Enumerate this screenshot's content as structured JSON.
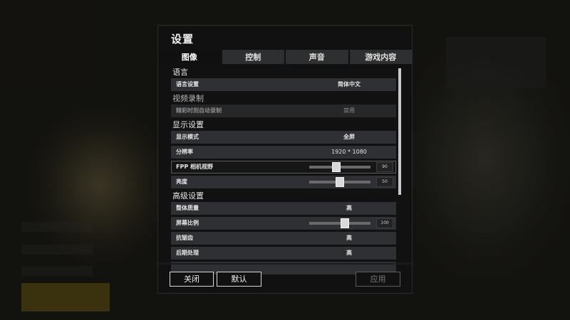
{
  "dialog": {
    "title": "设置",
    "tabs": [
      "图像",
      "控制",
      "声音",
      "游戏内容"
    ],
    "active_tab": "图像"
  },
  "sections": {
    "language": "语言",
    "video_record": "视频录制",
    "display": "显示设置",
    "advanced": "高级设置"
  },
  "rows": {
    "language_setting": {
      "label": "语言设置",
      "value": "简体中文"
    },
    "auto_record": {
      "label": "精彩时刻自动录制",
      "value": "禁用"
    },
    "display_mode": {
      "label": "显示模式",
      "value": "全屏"
    },
    "resolution": {
      "label": "分辨率",
      "value": "1920 * 1080"
    },
    "fpp_fov": {
      "label": "FPP 相机视野",
      "value": "90",
      "fraction": 0.43
    },
    "brightness": {
      "label": "亮度",
      "value": "50",
      "fraction": 0.5
    },
    "overall_quality": {
      "label": "整体质量",
      "value": "高"
    },
    "screen_scale": {
      "label": "屏幕比例",
      "value": "100",
      "fraction": 0.59
    },
    "anti_aliasing": {
      "label": "抗锯齿",
      "value": "高"
    },
    "post_processing": {
      "label": "后期处理",
      "value": "高"
    }
  },
  "buttons": {
    "close": "关闭",
    "default": "默认",
    "apply": "应用"
  },
  "colors": {
    "dialog_bg": "#111112",
    "row_bg": "#2f3033",
    "tab_bg": "#2e2f31",
    "disabled_text": "#7a7a7a"
  }
}
